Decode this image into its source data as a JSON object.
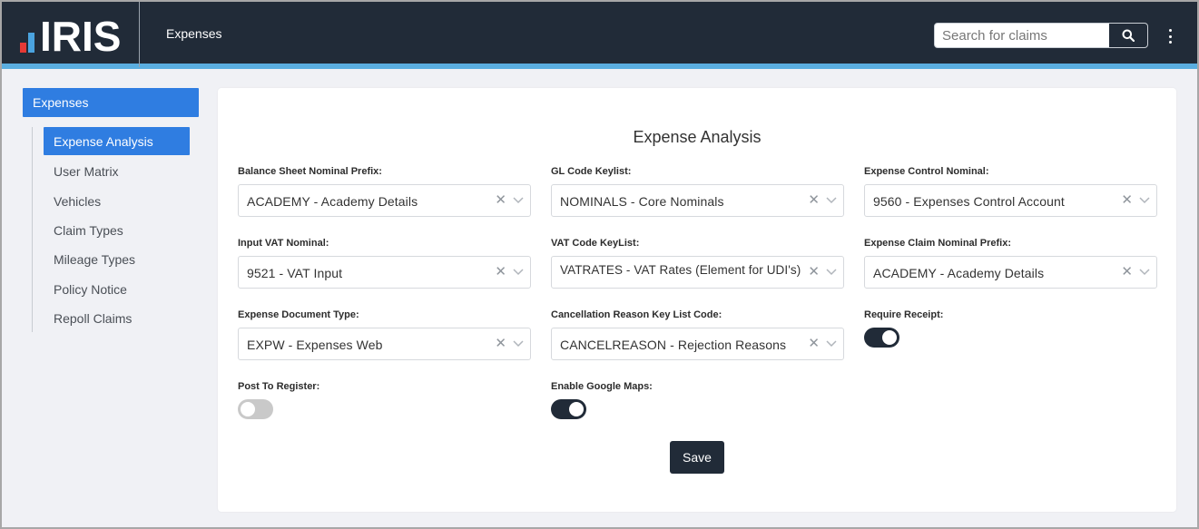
{
  "app": {
    "logo_text": "IRIS",
    "title": "Expenses"
  },
  "search": {
    "placeholder": "Search for claims",
    "value": ""
  },
  "sidebar": {
    "header": "Expenses",
    "items": [
      {
        "label": "Expense Analysis",
        "active": true
      },
      {
        "label": "User Matrix",
        "active": false
      },
      {
        "label": "Vehicles",
        "active": false
      },
      {
        "label": "Claim Types",
        "active": false
      },
      {
        "label": "Mileage Types",
        "active": false
      },
      {
        "label": "Policy Notice",
        "active": false
      },
      {
        "label": "Repoll Claims",
        "active": false
      }
    ]
  },
  "form": {
    "title": "Expense Analysis",
    "fields": {
      "balance_sheet": {
        "label": "Balance Sheet Nominal Prefix:",
        "value": "ACADEMY - Academy Details"
      },
      "gl_code": {
        "label": "GL Code Keylist:",
        "value": "NOMINALS - Core Nominals"
      },
      "expense_control": {
        "label": "Expense Control Nominal:",
        "value": "9560 - Expenses Control Account"
      },
      "input_vat": {
        "label": "Input VAT Nominal:",
        "value": "9521 - VAT Input"
      },
      "vat_code": {
        "label": "VAT Code KeyList:",
        "value": "VATRATES - VAT Rates (Element for UDI's)"
      },
      "expense_claim": {
        "label": "Expense Claim Nominal Prefix:",
        "value": "ACADEMY - Academy Details"
      },
      "document_type": {
        "label": "Expense Document Type:",
        "value": "EXPW - Expenses Web"
      },
      "cancellation": {
        "label": "Cancellation Reason Key List Code:",
        "value": "CANCELREASON - Rejection Reasons"
      }
    },
    "toggles": {
      "require_receipt": {
        "label": "Require Receipt:",
        "on": true
      },
      "post_to_register": {
        "label": "Post To Register:",
        "on": false
      },
      "google_maps": {
        "label": "Enable Google Maps:",
        "on": true
      }
    },
    "save_label": "Save",
    "clear_glyph": "✕"
  },
  "icons": {
    "search": "search-icon",
    "kebab": "more-vertical-icon",
    "clear": "clear-icon",
    "chevron": "chevron-down-icon"
  },
  "colors": {
    "header_bg": "#212b38",
    "accent_strip": "#5aaee0",
    "active_blue": "#2f7de1",
    "toggle_on": "#212b38",
    "toggle_off": "#c9c9c9",
    "logo_red": "#e53935",
    "logo_blue": "#4aa3df"
  }
}
